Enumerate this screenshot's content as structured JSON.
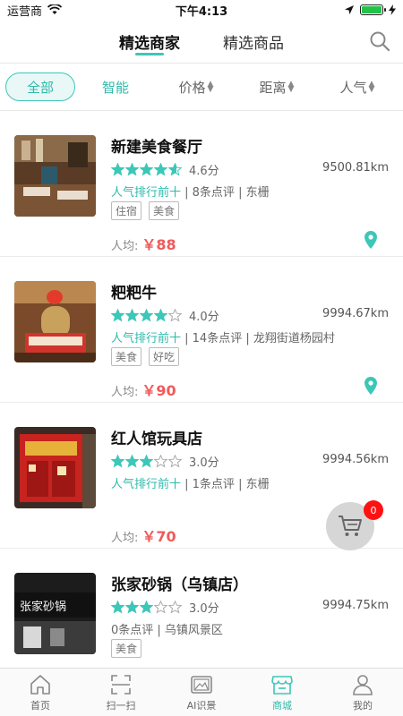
{
  "status": {
    "carrier": "运营商",
    "time": "下午4:13"
  },
  "top_tabs": [
    {
      "label": "精选商家",
      "active": true
    },
    {
      "label": "精选商品",
      "active": false
    }
  ],
  "filters": [
    "全部",
    "智能",
    "价格",
    "距离",
    "人气"
  ],
  "merchants": [
    {
      "name": "新建美食餐厅",
      "rating": 4.6,
      "rating_text": "4.6分",
      "distance": "9500.81km",
      "hot": "人气排行前十",
      "meta_rest": " | 8条点评 | 东栅",
      "tags": [
        "住宿",
        "美食"
      ],
      "price_label": "人均:",
      "price": "￥88"
    },
    {
      "name": "粑粑牛",
      "rating": 4.0,
      "rating_text": "4.0分",
      "distance": "9994.67km",
      "hot": "人气排行前十",
      "meta_rest": " | 14条点评 | 龙翔街道杨园村",
      "tags": [
        "美食",
        "好吃"
      ],
      "price_label": "人均:",
      "price": "￥90"
    },
    {
      "name": "红人馆玩具店",
      "rating": 3.0,
      "rating_text": "3.0分",
      "distance": "9994.56km",
      "hot": "人气排行前十",
      "meta_rest": " | 1条点评 | 东栅",
      "tags": [],
      "price_label": "人均:",
      "price": "￥70"
    },
    {
      "name": "张家砂锅（乌镇店）",
      "rating": 3.0,
      "rating_text": "3.0分",
      "distance": "9994.75km",
      "hot": "",
      "meta_rest": "0条点评 | 乌镇风景区",
      "tags": [
        "美食"
      ],
      "price_label": "",
      "price": ""
    }
  ],
  "cart": {
    "count": "0"
  },
  "bottom_nav": [
    {
      "label": "首页",
      "icon": "home-icon",
      "active": false
    },
    {
      "label": "扫一扫",
      "icon": "scan-icon",
      "active": false
    },
    {
      "label": "AI识景",
      "icon": "ai-photo-icon",
      "active": false
    },
    {
      "label": "商城",
      "icon": "shop-icon",
      "active": true
    },
    {
      "label": "我的",
      "icon": "user-icon",
      "active": false
    }
  ],
  "colors": {
    "accent": "#3cc7b8",
    "price": "#f05a5a",
    "badge": "#ff1111"
  }
}
